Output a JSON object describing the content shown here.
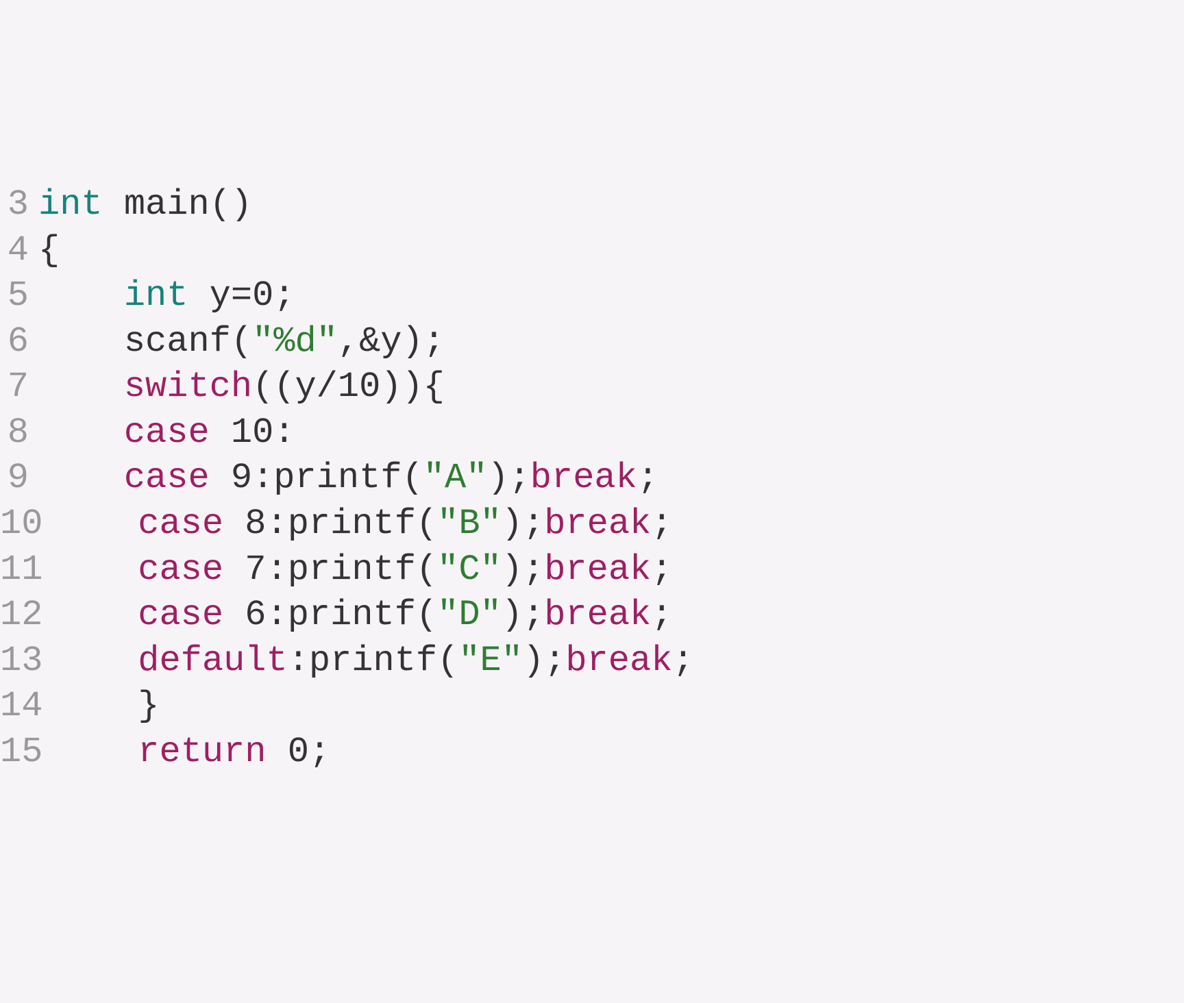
{
  "lines": [
    {
      "num": "3",
      "tokens": [
        {
          "cls": "kw-type",
          "t": "int"
        },
        {
          "cls": "punct",
          "t": " "
        },
        {
          "cls": "ident",
          "t": "main()"
        }
      ]
    },
    {
      "num": "4",
      "tokens": [
        {
          "cls": "punct",
          "t": "{"
        }
      ]
    },
    {
      "num": "5",
      "tokens": [
        {
          "cls": "punct",
          "t": "    "
        },
        {
          "cls": "kw-type",
          "t": "int"
        },
        {
          "cls": "punct",
          "t": " y="
        },
        {
          "cls": "num",
          "t": "0"
        },
        {
          "cls": "punct",
          "t": ";"
        }
      ]
    },
    {
      "num": "6",
      "tokens": [
        {
          "cls": "punct",
          "t": "    "
        },
        {
          "cls": "ident",
          "t": "scanf("
        },
        {
          "cls": "str",
          "t": "\"%d\""
        },
        {
          "cls": "punct",
          "t": ",&y);"
        }
      ]
    },
    {
      "num": "7",
      "tokens": [
        {
          "cls": "punct",
          "t": "    "
        },
        {
          "cls": "kw-control",
          "t": "switch"
        },
        {
          "cls": "punct",
          "t": "((y/"
        },
        {
          "cls": "num",
          "t": "10"
        },
        {
          "cls": "punct",
          "t": ")){"
        }
      ]
    },
    {
      "num": "8",
      "tokens": [
        {
          "cls": "punct",
          "t": "    "
        },
        {
          "cls": "kw-control",
          "t": "case"
        },
        {
          "cls": "punct",
          "t": " "
        },
        {
          "cls": "num",
          "t": "10"
        },
        {
          "cls": "punct",
          "t": ":"
        }
      ]
    },
    {
      "num": "9",
      "tokens": [
        {
          "cls": "punct",
          "t": "    "
        },
        {
          "cls": "kw-control",
          "t": "case"
        },
        {
          "cls": "punct",
          "t": " "
        },
        {
          "cls": "num",
          "t": "9"
        },
        {
          "cls": "punct",
          "t": ":printf("
        },
        {
          "cls": "str",
          "t": "\"A\""
        },
        {
          "cls": "punct",
          "t": ");"
        },
        {
          "cls": "kw-control",
          "t": "break"
        },
        {
          "cls": "punct",
          "t": ";"
        }
      ]
    },
    {
      "num": "10",
      "tokens": [
        {
          "cls": "punct",
          "t": "    "
        },
        {
          "cls": "kw-control",
          "t": "case"
        },
        {
          "cls": "punct",
          "t": " "
        },
        {
          "cls": "num",
          "t": "8"
        },
        {
          "cls": "punct",
          "t": ":printf("
        },
        {
          "cls": "str",
          "t": "\"B\""
        },
        {
          "cls": "punct",
          "t": ");"
        },
        {
          "cls": "kw-control",
          "t": "break"
        },
        {
          "cls": "punct",
          "t": ";"
        }
      ]
    },
    {
      "num": "11",
      "tokens": [
        {
          "cls": "punct",
          "t": "    "
        },
        {
          "cls": "kw-control",
          "t": "case"
        },
        {
          "cls": "punct",
          "t": " "
        },
        {
          "cls": "num",
          "t": "7"
        },
        {
          "cls": "punct",
          "t": ":printf("
        },
        {
          "cls": "str",
          "t": "\"C\""
        },
        {
          "cls": "punct",
          "t": ");"
        },
        {
          "cls": "kw-control",
          "t": "break"
        },
        {
          "cls": "punct",
          "t": ";"
        }
      ]
    },
    {
      "num": "12",
      "tokens": [
        {
          "cls": "punct",
          "t": "    "
        },
        {
          "cls": "kw-control",
          "t": "case"
        },
        {
          "cls": "punct",
          "t": " "
        },
        {
          "cls": "num",
          "t": "6"
        },
        {
          "cls": "punct",
          "t": ":printf("
        },
        {
          "cls": "str",
          "t": "\"D\""
        },
        {
          "cls": "punct",
          "t": ");"
        },
        {
          "cls": "kw-control",
          "t": "break"
        },
        {
          "cls": "punct",
          "t": ";"
        }
      ]
    },
    {
      "num": "13",
      "tokens": [
        {
          "cls": "punct",
          "t": "    "
        },
        {
          "cls": "kw-control",
          "t": "default"
        },
        {
          "cls": "punct",
          "t": ":printf("
        },
        {
          "cls": "str",
          "t": "\"E\""
        },
        {
          "cls": "punct",
          "t": ");"
        },
        {
          "cls": "kw-control",
          "t": "break"
        },
        {
          "cls": "punct",
          "t": ";"
        }
      ]
    },
    {
      "num": "14",
      "tokens": [
        {
          "cls": "punct",
          "t": "    }"
        }
      ]
    },
    {
      "num": "15",
      "tokens": [
        {
          "cls": "punct",
          "t": "    "
        },
        {
          "cls": "kw-control",
          "t": "return"
        },
        {
          "cls": "punct",
          "t": " "
        },
        {
          "cls": "num",
          "t": "0"
        },
        {
          "cls": "punct",
          "t": ";"
        }
      ]
    }
  ]
}
